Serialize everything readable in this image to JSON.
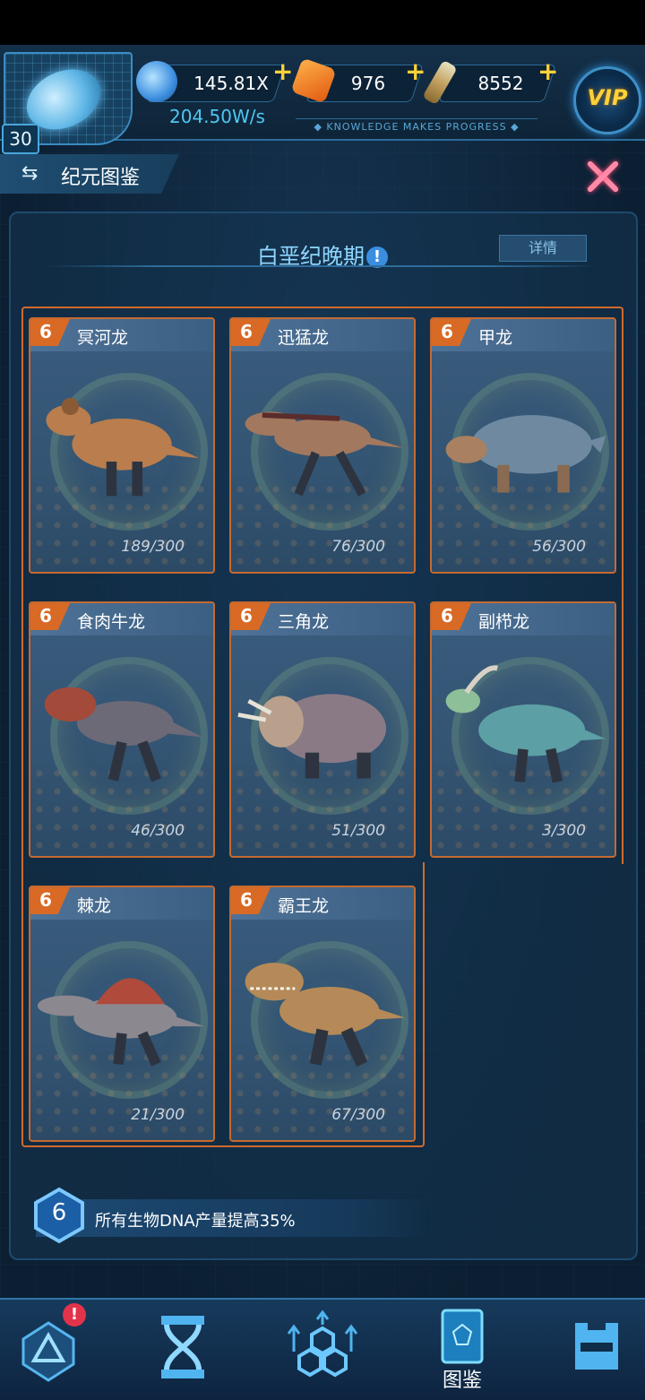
{
  "player": {
    "level": "30"
  },
  "resources": {
    "dna": {
      "value": "145.81X",
      "rate": "204.50W/s",
      "icon": "dna-crystal-icon"
    },
    "amber": {
      "value": "976",
      "icon": "amber-gem-icon"
    },
    "serum": {
      "value": "8552",
      "icon": "syringe-icon"
    },
    "plus_symbol": "+"
  },
  "slogan": "◆ KNOWLEDGE MAKES PROGRESS ◆",
  "vip_label": "VIP",
  "header": {
    "title": "纪元图鉴",
    "swap_icon": "⇆"
  },
  "era": {
    "title": "白垩纪晚期",
    "info_symbol": "!",
    "detail_label": "详情"
  },
  "cards": [
    {
      "level": "6",
      "name": "冥河龙",
      "count": "189/300",
      "body_color": "#b97d4e",
      "accent_color": "#8a5a34"
    },
    {
      "level": "6",
      "name": "迅猛龙",
      "count": "76/300",
      "body_color": "#a2785e",
      "accent_color": "#5a2c2c"
    },
    {
      "level": "6",
      "name": "甲龙",
      "count": "56/300",
      "body_color": "#6f8aa0",
      "accent_color": "#a98060"
    },
    {
      "level": "6",
      "name": "食肉牛龙",
      "count": "46/300",
      "body_color": "#6d6a78",
      "accent_color": "#a34a3a"
    },
    {
      "level": "6",
      "name": "三角龙",
      "count": "51/300",
      "body_color": "#8a7a86",
      "accent_color": "#b9a08c"
    },
    {
      "level": "6",
      "name": "副栉龙",
      "count": "3/300",
      "body_color": "#5c9fa4",
      "accent_color": "#8dbf98"
    },
    {
      "level": "6",
      "name": "棘龙",
      "count": "21/300",
      "body_color": "#8c8890",
      "accent_color": "#b04a3a"
    },
    {
      "level": "6",
      "name": "霸王龙",
      "count": "67/300",
      "body_color": "#b58a58",
      "accent_color": "#6a4a2e"
    }
  ],
  "bonus": {
    "level": "6",
    "text": "所有生物DNA产量提高35%"
  },
  "nav": {
    "items": [
      {
        "icon": "triangle-emblem-icon",
        "badge": "!"
      },
      {
        "icon": "dna-hourglass-icon"
      },
      {
        "icon": "hexagon-cluster-icon"
      },
      {
        "icon": "codex-book-icon",
        "label": "图鉴"
      },
      {
        "icon": "castle-gate-icon"
      }
    ]
  },
  "colors": {
    "accent_orange": "#d06a2c",
    "accent_blue": "#3a8cc2",
    "gold": "#ffd23a"
  }
}
